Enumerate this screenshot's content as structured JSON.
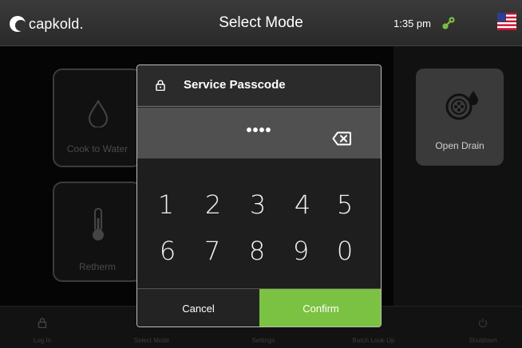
{
  "header": {
    "brand": "capkold.",
    "title": "Select Mode",
    "time": "1:35 pm"
  },
  "tiles": {
    "cook_to_water": "Cook to Water",
    "retherm": "Retherm",
    "open_drain": "Open Drain"
  },
  "modal": {
    "title": "Service Passcode",
    "passcode_mask": "••••",
    "keys": [
      "1",
      "2",
      "3",
      "4",
      "5",
      "6",
      "7",
      "8",
      "9",
      "0"
    ],
    "cancel_label": "Cancel",
    "confirm_label": "Confirm"
  },
  "bottom_nav": {
    "items": [
      {
        "label": "Log In",
        "icon": "lock-icon"
      },
      {
        "label": "Select Mode",
        "icon": "none"
      },
      {
        "label": "Settings",
        "icon": "none"
      },
      {
        "label": "Batch Look-Up",
        "icon": "none"
      },
      {
        "label": "Shutdown",
        "icon": "power-icon"
      }
    ]
  },
  "colors": {
    "confirm": "#7cc242",
    "link_icon": "#7cc242",
    "header_bg": "#333333",
    "modal_bg": "#1e1e1e"
  }
}
